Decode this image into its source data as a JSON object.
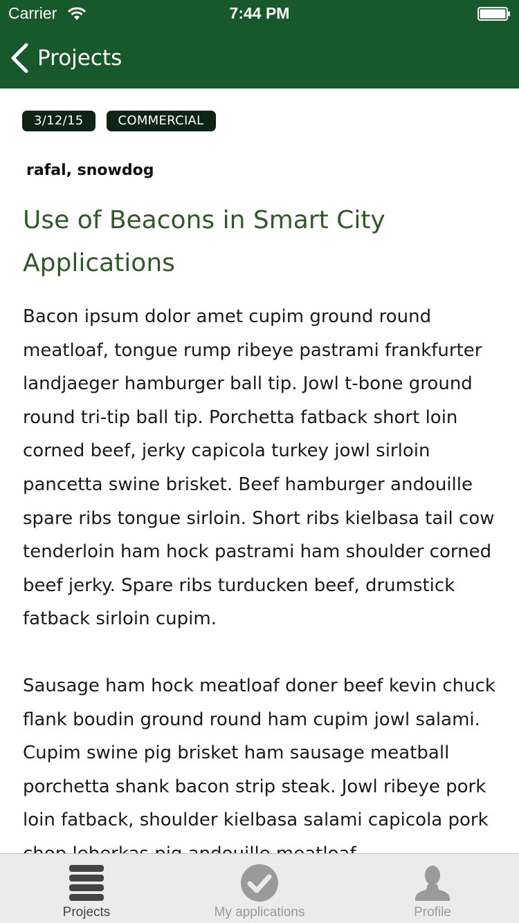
{
  "status_bar": {
    "carrier": "Carrier",
    "time": "7:44 PM"
  },
  "nav": {
    "back_label": "Projects"
  },
  "article": {
    "date": "3/12/15",
    "category": "COMMERCIAL",
    "authors": "rafal, snowdog",
    "title": "Use of Beacons in Smart City Applications",
    "paragraphs": [
      "Bacon ipsum dolor amet cupim ground round meatloaf, tongue rump ribeye pastrami frankfurter landjaeger hamburger ball tip. Jowl t-bone ground round tri-tip ball tip. Porchetta fatback short loin corned beef, jerky capicola turkey jowl sirloin pancetta swine brisket. Beef hamburger andouille spare ribs tongue sirloin. Short ribs kielbasa tail cow tenderloin ham hock pastrami ham shoulder corned beef jerky. Spare ribs turducken beef, drumstick fatback sirloin cupim.",
      "Sausage ham hock meatloaf doner beef kevin chuck flank boudin ground round ham cupim jowl salami. Cupim swine pig brisket ham sausage meatball porchetta shank bacon strip steak. Jowl ribeye pork loin fatback, shoulder kielbasa salami capicola pork chop leberkas pig andouille meatloaf."
    ]
  },
  "tab_bar": {
    "tabs": [
      {
        "label": "Projects",
        "icon": "list-icon",
        "active": true
      },
      {
        "label": "My applications",
        "icon": "checkmark-circle-icon",
        "active": false
      },
      {
        "label": "Profile",
        "icon": "person-icon",
        "active": false
      }
    ]
  },
  "colors": {
    "brand_green": "#17592a",
    "title_green": "#2f5a27",
    "badge_bg": "#0e2416"
  }
}
